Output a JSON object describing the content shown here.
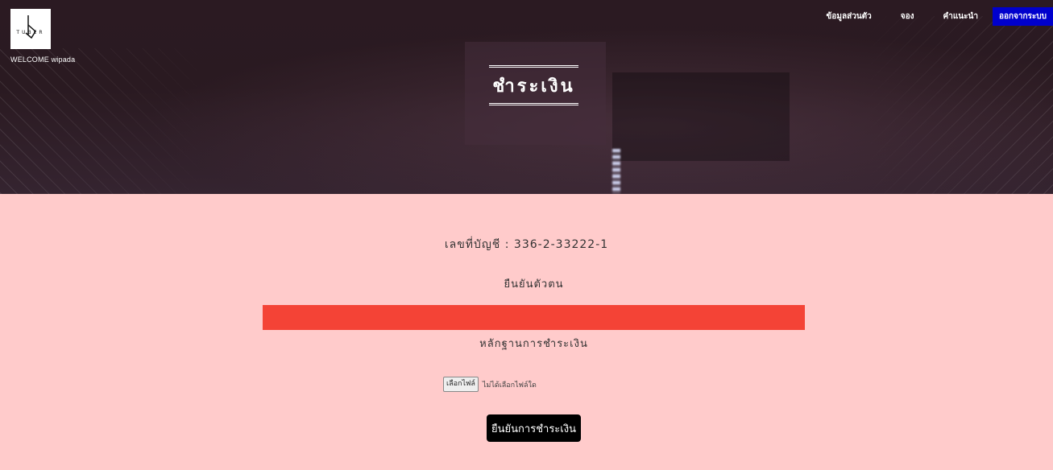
{
  "header": {
    "welcome_text": "WELCOME wipada",
    "logo_text": "TUBER",
    "title": "ชำระเงิน"
  },
  "nav": {
    "items": [
      {
        "label": "ข้อมูลส่วนตัว"
      },
      {
        "label": "จอง"
      },
      {
        "label": "คำแนะนำ"
      }
    ],
    "logout_label": "ออกจากระบบ"
  },
  "content": {
    "account_text": "เลขที่บัญชี : 336-2-33222-1",
    "verify_label": "ยืนยันตัวตน",
    "proof_label": "หลักฐานการชำระเงิน",
    "file_button_label": "เลือกไฟล์",
    "file_status": "ไม่ได้เลือกไฟล์ใด",
    "confirm_button_label": "ยืนยันการชำระเงิน"
  },
  "colors": {
    "page_background": "#ffcbcb",
    "alert_bar": "#f44336",
    "logout_button": "#0000cc",
    "confirm_button": "#000000"
  },
  "icons": [
    "logo-icon"
  ]
}
